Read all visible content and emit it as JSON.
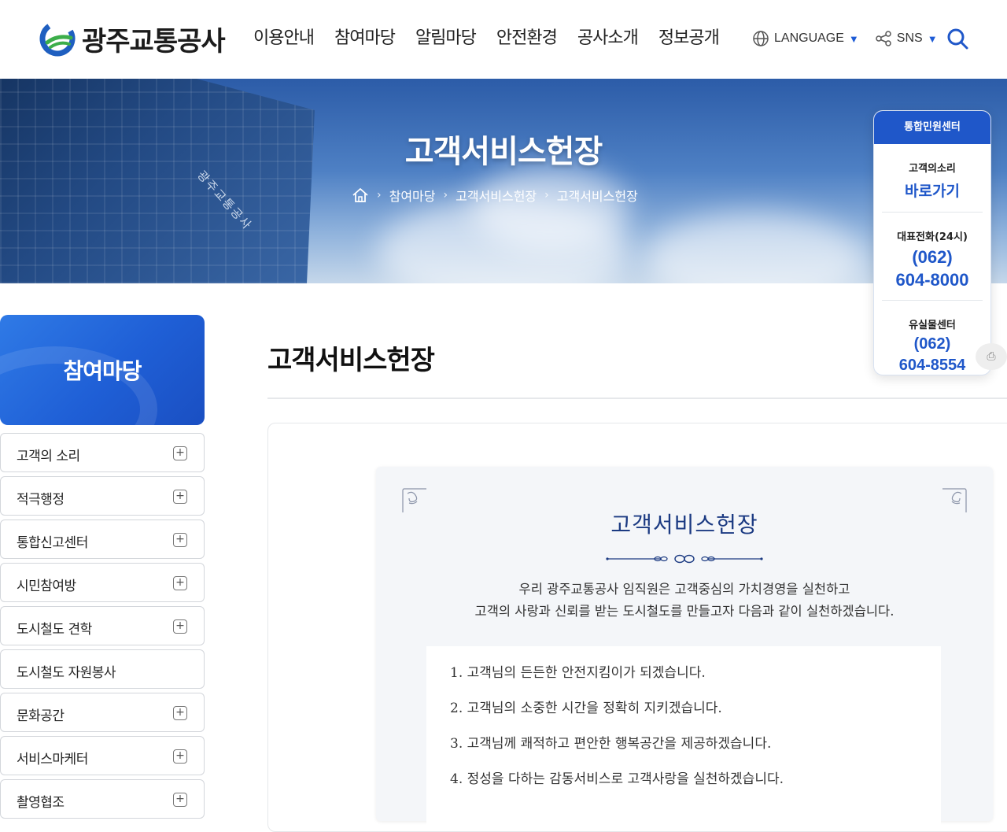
{
  "header": {
    "logo_text": "광주교통공사",
    "nav": [
      "이용안내",
      "참여마당",
      "알림마당",
      "안전환경",
      "공사소개",
      "정보공개"
    ],
    "language_label": "LANGUAGE",
    "sns_label": "SNS"
  },
  "banner": {
    "title": "고객서비스헌장",
    "building_sign": "광주교통공사",
    "breadcrumb": [
      "참여마당",
      "고객서비스헌장",
      "고객서비스헌장"
    ]
  },
  "floating": {
    "header": "통합민원센터",
    "voice_label": "고객의소리",
    "voice_link": "바로가기",
    "main_phone_label": "대표전화(24시)",
    "main_phone_area": "(062)",
    "main_phone_number": "604-8000",
    "lost_label": "유실물센터",
    "lost_phone_area": "(062)",
    "lost_phone_number": "604-8554"
  },
  "sidebar": {
    "title": "참여마당",
    "items": [
      {
        "label": "고객의 소리",
        "expandable": true
      },
      {
        "label": "적극행정",
        "expandable": true
      },
      {
        "label": "통합신고센터",
        "expandable": true
      },
      {
        "label": "시민참여방",
        "expandable": true
      },
      {
        "label": "도시철도 견학",
        "expandable": true
      },
      {
        "label": "도시철도 자원봉사",
        "expandable": false
      },
      {
        "label": "문화공간",
        "expandable": true
      },
      {
        "label": "서비스마케터",
        "expandable": true
      },
      {
        "label": "촬영협조",
        "expandable": true
      }
    ]
  },
  "content": {
    "page_title": "고객서비스헌장",
    "charter_title": "고객서비스헌장",
    "intro_line1": "우리 광주교통공사 임직원은 고객중심의 가치경영을 실천하고",
    "intro_line2": "고객의 사랑과 신뢰를 받는 도시철도를 만들고자 다음과 같이 실천하겠습니다.",
    "pledges": [
      "1. 고객님의 든든한 안전지킴이가 되겠습니다.",
      "2. 고객님의 소중한 시간을 정확히 지키겠습니다.",
      "3. 고객님께 쾌적하고 편안한 행복공간을 제공하겠습니다.",
      "4. 정성을 다하는 감동서비스로 고객사랑을 실천하겠습니다."
    ]
  },
  "colors": {
    "accent": "#1f57c9",
    "charter_title": "#1b3a82"
  }
}
